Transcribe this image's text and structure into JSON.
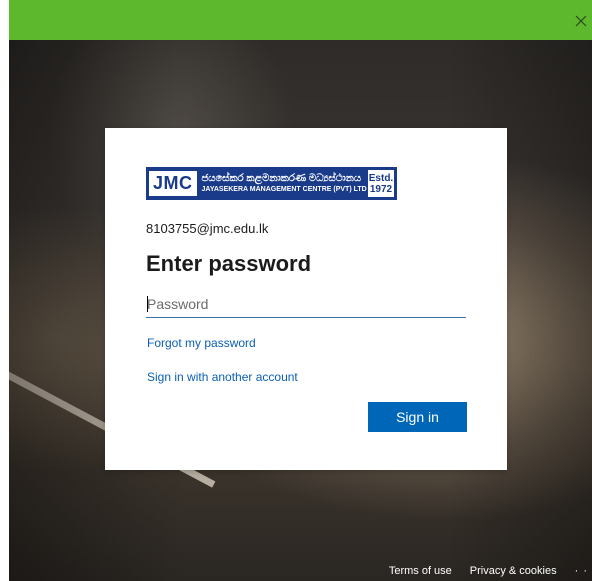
{
  "title_bar": {
    "accent_color": "#5db82e",
    "close_icon": "close-icon"
  },
  "logo": {
    "abbr": "JMC",
    "name_sinhala": "ජයසේකර කළමනාකරණ මධ්‍යස්ථානය",
    "name_english": "JAYASEKERA MANAGEMENT CENTRE (PVT) LTD",
    "estd_label": "Estd.",
    "estd_year": "1972",
    "brand_color": "#1a3a8a"
  },
  "signin": {
    "user_email": "8103755@jmc.edu.lk",
    "heading": "Enter password",
    "password_placeholder": "Password",
    "password_value": "",
    "forgot_link": "Forgot my password",
    "another_account_link": "Sign in with another account",
    "submit_label": "Sign in",
    "button_color": "#0067b8",
    "link_color": "#0b5fb3"
  },
  "footer": {
    "terms_link": "Terms of use",
    "privacy_link": "Privacy & cookies",
    "more_label": "· ·"
  }
}
